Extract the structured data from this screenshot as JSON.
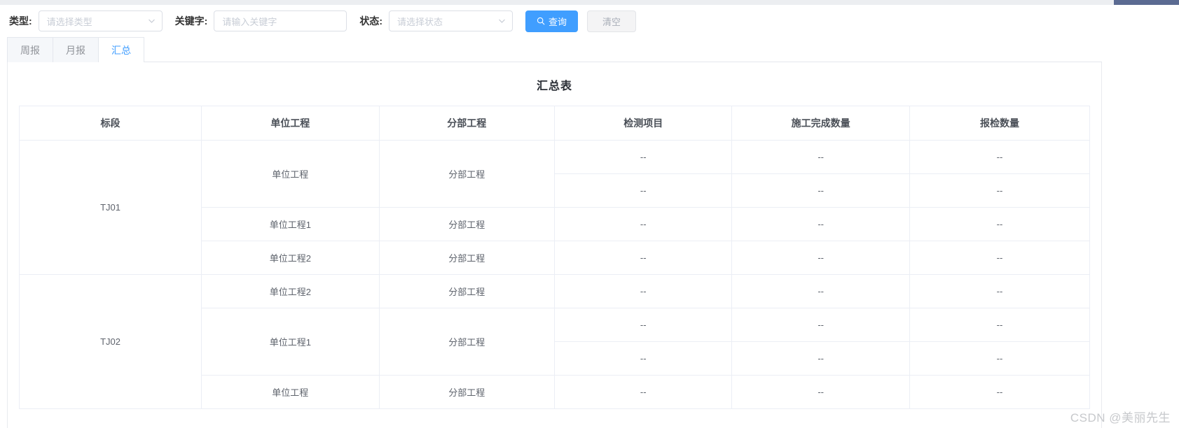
{
  "scrollbar": {
    "thumb_color": "#5b6b92",
    "track_color": "#eceef1"
  },
  "theme": {
    "primary": "#409eff",
    "text": "#5e636c",
    "border": "#ebeef5"
  },
  "filters": {
    "type": {
      "label": "类型:",
      "placeholder": "请选择类型",
      "value": "",
      "icon": "chevron-down-icon"
    },
    "keyword": {
      "label": "关键字:",
      "placeholder": "请输入关键字",
      "value": ""
    },
    "status": {
      "label": "状态:",
      "placeholder": "请选择状态",
      "value": "",
      "icon": "chevron-down-icon"
    },
    "query_button": {
      "label": "查询",
      "icon": "search-icon"
    },
    "clear_button": {
      "label": "清空"
    }
  },
  "tabs": [
    {
      "label": "周报",
      "active": false
    },
    {
      "label": "月报",
      "active": false
    },
    {
      "label": "汇总",
      "active": true
    }
  ],
  "table": {
    "title": "汇总表",
    "columns": [
      "标段",
      "单位工程",
      "分部工程",
      "检测项目",
      "施工完成数量",
      "报检数量"
    ],
    "sections": [
      {
        "bid": "TJ01",
        "units": [
          {
            "name": "单位工程",
            "division": "分部工程",
            "rows": [
              {
                "item": "--",
                "completed": "--",
                "inspected": "--"
              },
              {
                "item": "--",
                "completed": "--",
                "inspected": "--"
              }
            ]
          },
          {
            "name": "单位工程1",
            "division": "分部工程",
            "rows": [
              {
                "item": "--",
                "completed": "--",
                "inspected": "--"
              }
            ]
          },
          {
            "name": "单位工程2",
            "division": "分部工程",
            "rows": [
              {
                "item": "--",
                "completed": "--",
                "inspected": "--"
              }
            ]
          }
        ]
      },
      {
        "bid": "TJ02",
        "units": [
          {
            "name": "单位工程2",
            "division": "分部工程",
            "rows": [
              {
                "item": "--",
                "completed": "--",
                "inspected": "--"
              }
            ]
          },
          {
            "name": "单位工程1",
            "division": "分部工程",
            "rows": [
              {
                "item": "--",
                "completed": "--",
                "inspected": "--"
              },
              {
                "item": "--",
                "completed": "--",
                "inspected": "--"
              }
            ]
          },
          {
            "name": "单位工程",
            "division": "分部工程",
            "rows": [
              {
                "item": "--",
                "completed": "--",
                "inspected": "--"
              }
            ]
          }
        ]
      }
    ]
  },
  "watermark": {
    "text": "CSDN @美丽先生"
  }
}
